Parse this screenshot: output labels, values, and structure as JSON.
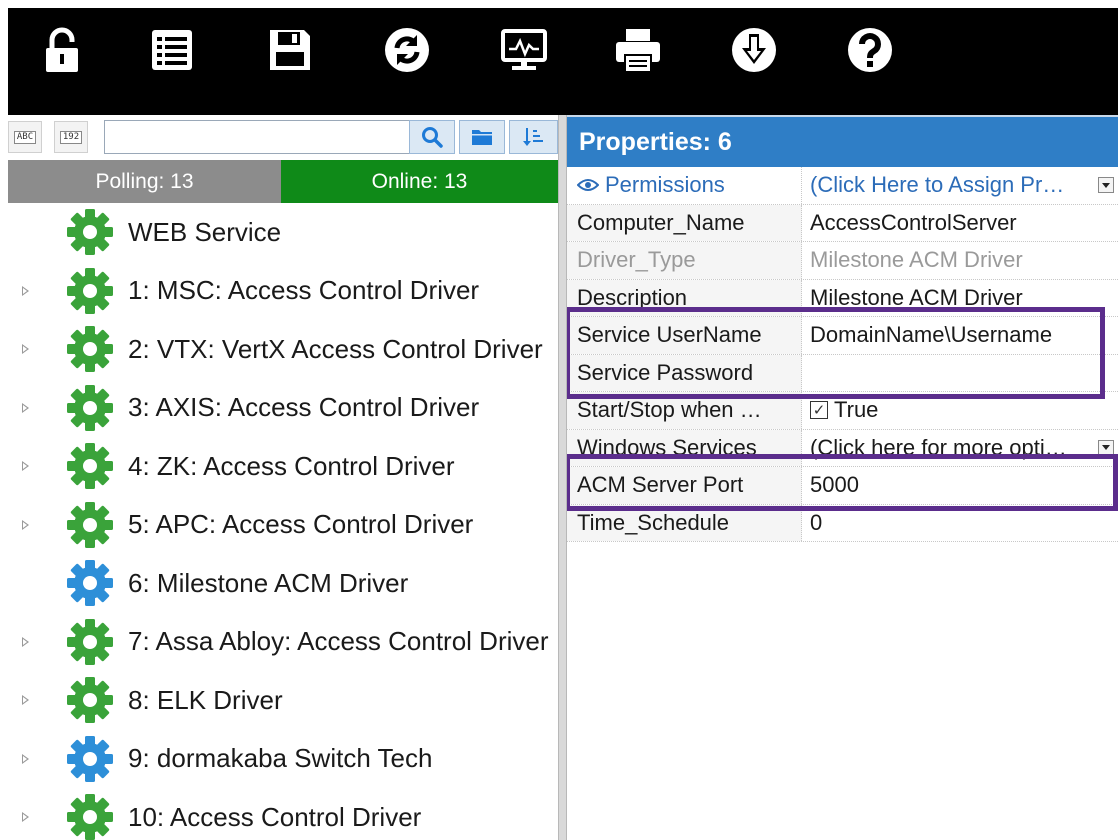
{
  "toolbar": {
    "buttons": [
      {
        "icon": "lock-icon"
      },
      {
        "icon": "list-icon"
      },
      {
        "icon": "save-icon"
      },
      {
        "icon": "refresh-icon"
      },
      {
        "icon": "monitor-icon"
      },
      {
        "icon": "printer-icon"
      },
      {
        "icon": "download-icon"
      },
      {
        "icon": "help-icon"
      }
    ]
  },
  "left_pane": {
    "tools": {
      "sort_alpha": "ABC",
      "sort_numeric": "192"
    },
    "search": {
      "value": "",
      "placeholder": ""
    },
    "status": {
      "polling": "Polling: 13",
      "online": "Online: 13",
      "polling_color": "#8c8c8c",
      "online_color": "#0f8a18"
    },
    "tree": [
      {
        "label": "WEB Service",
        "gear_color": "#3aa33a",
        "expandable": false
      },
      {
        "label": "1:  MSC: Access Control Driver",
        "gear_color": "#3aa33a",
        "expandable": true
      },
      {
        "label": "2:  VTX: VertX Access Control Driver",
        "gear_color": "#3aa33a",
        "expandable": true
      },
      {
        "label": "3:  AXIS: Access Control Driver",
        "gear_color": "#3aa33a",
        "expandable": true
      },
      {
        "label": "4:  ZK: Access Control Driver",
        "gear_color": "#3aa33a",
        "expandable": true
      },
      {
        "label": "5:  APC: Access Control Driver",
        "gear_color": "#3aa33a",
        "expandable": true
      },
      {
        "label": "6:  Milestone ACM Driver",
        "gear_color": "#2d8fd8",
        "expandable": false
      },
      {
        "label": "7:  Assa Abloy: Access Control Driver",
        "gear_color": "#3aa33a",
        "expandable": true
      },
      {
        "label": "8:  ELK Driver",
        "gear_color": "#3aa33a",
        "expandable": true
      },
      {
        "label": "9:  dormakaba Switch Tech",
        "gear_color": "#2d8fd8",
        "expandable": true
      },
      {
        "label": "10:  Access Control Driver",
        "gear_color": "#3aa33a",
        "expandable": true
      }
    ]
  },
  "properties": {
    "title": "Properties:  6",
    "header_color": "#2f7ec6",
    "rows": [
      {
        "name": "Permissions",
        "value": "(Click Here to Assign Pr…",
        "style": "perm"
      },
      {
        "name": "Computer_Name",
        "value": "AccessControlServer",
        "style": "normal"
      },
      {
        "name": "Driver_Type",
        "value": "Milestone ACM Driver",
        "style": "disabled"
      },
      {
        "name": "Description",
        "value": "Milestone ACM Driver",
        "style": "normal"
      },
      {
        "name": "Service UserName",
        "value": "DomainName\\Username",
        "style": "normal"
      },
      {
        "name": "Service Password",
        "value": "",
        "style": "normal"
      },
      {
        "name": "Start/Stop when …",
        "value": "True",
        "style": "check"
      },
      {
        "name": "Windows Services",
        "value": "(Click here for more opti…",
        "style": "dropdown"
      },
      {
        "name": "ACM Server Port",
        "value": "5000",
        "style": "normal"
      },
      {
        "name": "Time_Schedule",
        "value": "0",
        "style": "normal"
      }
    ],
    "highlight_color": "#5b2d8c"
  }
}
